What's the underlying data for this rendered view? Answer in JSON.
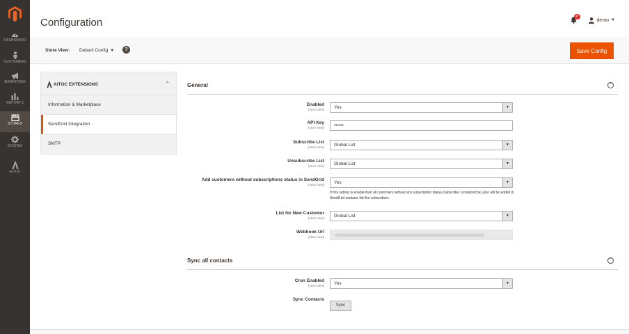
{
  "nav": {
    "items": [
      {
        "label": "DASHBOARD",
        "icon": "dashboard-icon"
      },
      {
        "label": "CUSTOMERS",
        "icon": "customers-icon"
      },
      {
        "label": "MARKETING",
        "icon": "marketing-icon"
      },
      {
        "label": "REPORTS",
        "icon": "reports-icon"
      },
      {
        "label": "STORES",
        "icon": "stores-icon"
      },
      {
        "label": "SYSTEM",
        "icon": "system-icon"
      },
      {
        "label": "AITOC",
        "icon": "aitoc-icon"
      }
    ],
    "active": "STORES",
    "colors": {
      "bg": "#373330",
      "active_bg": "#514943"
    }
  },
  "header": {
    "title": "Configuration",
    "notifications_count": "37",
    "user": "demo"
  },
  "scope_bar": {
    "label": "Store View:",
    "value": "Default Config",
    "save_label": "Save Config",
    "save_color": "#eb5202"
  },
  "tabs": {
    "group_title": "AITOC EXTENSIONS",
    "items": [
      {
        "label": "Information & Marketplace"
      },
      {
        "label": "SendGrid Integration"
      },
      {
        "label": "SMTP"
      }
    ]
  },
  "general": {
    "title": "General",
    "fields": {
      "enabled": {
        "label": "Enabled",
        "scope": "[store view]",
        "value": "Yes"
      },
      "api_key": {
        "label": "API Key",
        "scope": "[store view]",
        "value": "••••••"
      },
      "subscribe_list": {
        "label": "Subscribe List",
        "scope": "[store view]",
        "value": "Global List"
      },
      "unsubscribe_list": {
        "label": "Unsubscribe List",
        "scope": "[store view]",
        "value": "Global List"
      },
      "add_customers": {
        "label": "Add customers without subscriptions status in SendGrid",
        "scope": "[store view]",
        "value": "Yes",
        "note": "If this setting is enable than all customers without any subscription status (subscribe / unsubsricbe) also will be added in SendGrid contacts list like subscribers."
      },
      "list_new_customer": {
        "label": "List for New Customer",
        "scope": "[store view]",
        "value": "Global List"
      },
      "webhook_url": {
        "label": "Webhook Url",
        "scope": "[store view]"
      }
    }
  },
  "sync": {
    "title": "Sync all contacts",
    "fields": {
      "cron_enabled": {
        "label": "Cron Enabled",
        "scope": "[store view]",
        "value": "Yes"
      },
      "sync_contacts": {
        "label": "Sync Contacts",
        "button": "Sync"
      }
    }
  }
}
